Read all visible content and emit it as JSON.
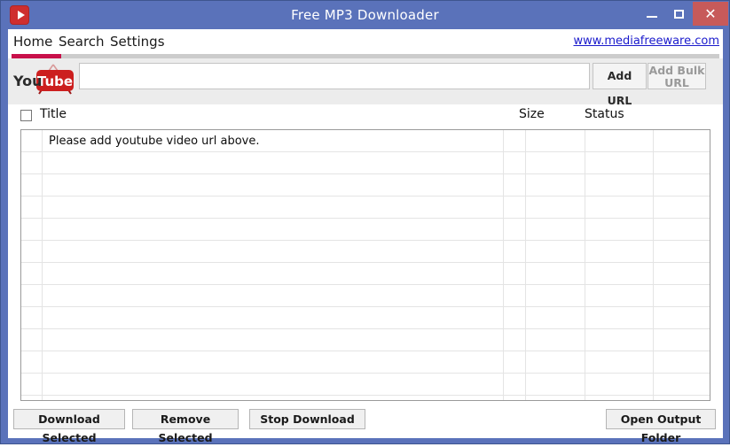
{
  "window": {
    "title": "Free MP3 Downloader",
    "icon": "play-app-icon",
    "controls": {
      "minimize": "–",
      "maximize": "□",
      "close": "✕"
    },
    "titlebar_color": "#5a72ba",
    "close_button_color": "#c75a5a"
  },
  "menu": {
    "items": [
      {
        "label": "Home",
        "active": true
      },
      {
        "label": "Search",
        "active": false
      },
      {
        "label": "Settings",
        "active": false
      }
    ],
    "site_link": "www.mediafreeware.com",
    "active_underline_color": "#c8104a",
    "track_color": "#cccccc"
  },
  "toolbar": {
    "logo": "youtube-logo",
    "logo_text_you": "You",
    "logo_text_tube": "Tube",
    "url_value": "",
    "url_placeholder": "",
    "add_url_label": "Add URL",
    "add_bulk_url_label": "Add Bulk URL",
    "add_bulk_url_line1": "Add Bulk",
    "add_bulk_url_line2": "URL",
    "add_bulk_disabled": true
  },
  "table": {
    "select_all_checked": false,
    "columns": [
      {
        "key": "checkbox",
        "label": ""
      },
      {
        "key": "title",
        "label": "Title"
      },
      {
        "key": "size",
        "label": "Size"
      },
      {
        "key": "status",
        "label": "Status"
      }
    ],
    "empty_message": "Please add youtube video url above.",
    "rows": [],
    "row_count_visible": 12
  },
  "footer": {
    "download_selected": "Download Selected",
    "remove_selected": "Remove Selected",
    "stop_download": "Stop Download",
    "open_output_folder": "Open Output Folder"
  }
}
